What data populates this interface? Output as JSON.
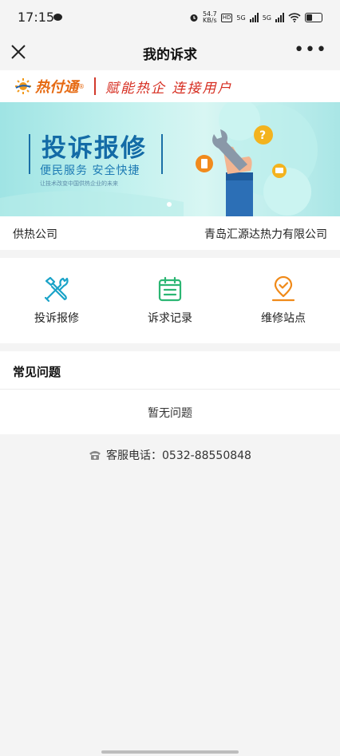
{
  "status_bar": {
    "time": "17:15",
    "net_speed_value": "54.7",
    "net_speed_unit": "KB/s",
    "hd_label": "HD",
    "sim1_label": "5G",
    "sim2_label": "5G"
  },
  "nav": {
    "title": "我的诉求"
  },
  "brand": {
    "name": "热付通",
    "reg_mark": "®",
    "slogan": "赋能热企  连接用户",
    "accent_color": "#e66a12",
    "slogan_color": "#d62d20"
  },
  "banner": {
    "title": "投诉报修",
    "subtitle": "便民服务  安全快捷",
    "tagline": "让技术改变中国供热企业的未来"
  },
  "company": {
    "label": "供热公司",
    "value": "青岛汇源达热力有限公司"
  },
  "actions": [
    {
      "label": "投诉报修",
      "icon": "tools-icon",
      "color": "#1aa3c8"
    },
    {
      "label": "诉求记录",
      "icon": "calendar-list-icon",
      "color": "#2bb673"
    },
    {
      "label": "维修站点",
      "icon": "location-pin-icon",
      "color": "#f08a19"
    }
  ],
  "faq": {
    "heading": "常见问题",
    "empty_text": "暂无问题"
  },
  "hotline": {
    "icon": "phone-icon",
    "label": "客服电话：",
    "number": "0532-88550848"
  }
}
